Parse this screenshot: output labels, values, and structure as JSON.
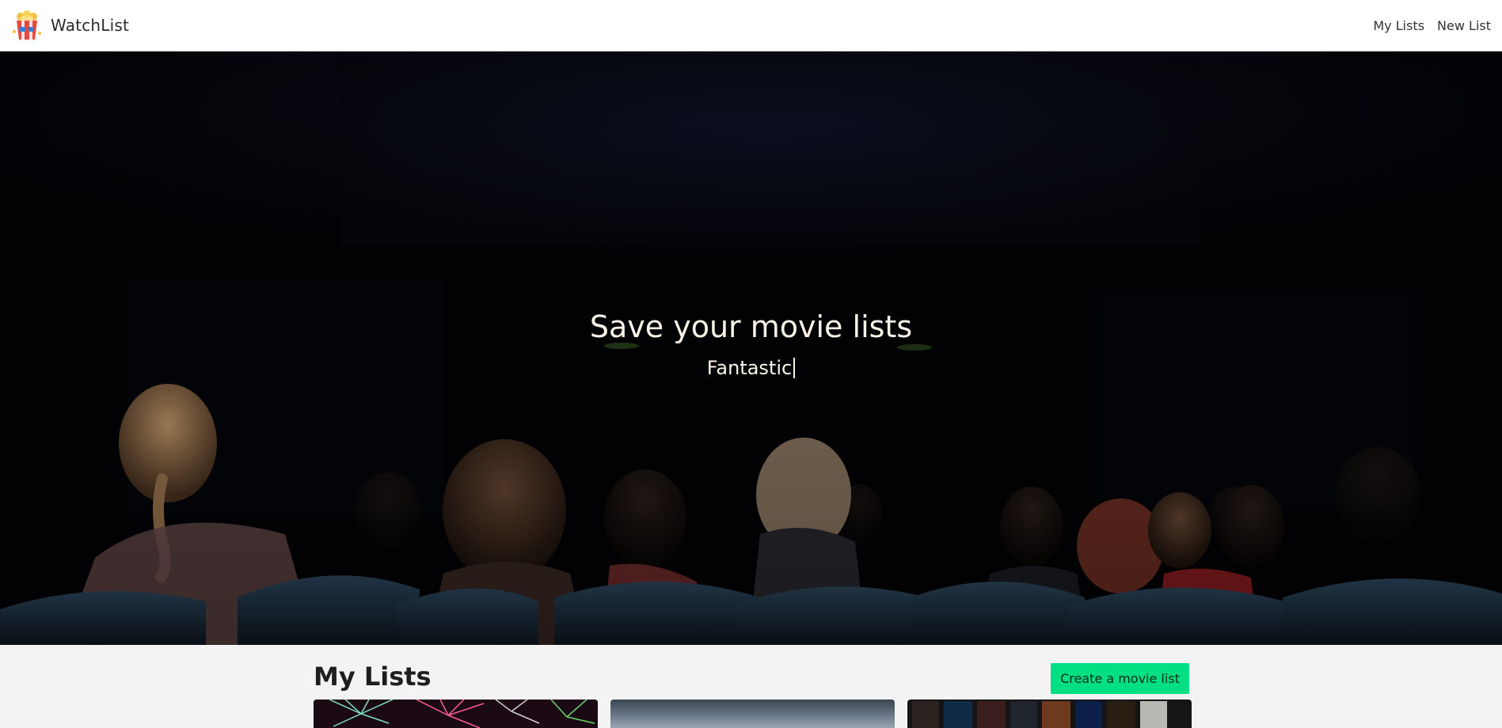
{
  "app": {
    "brand": "WatchList",
    "logo_icon": "popcorn-icon"
  },
  "nav": {
    "items": [
      {
        "label": "My Lists"
      },
      {
        "label": "New List"
      }
    ]
  },
  "hero": {
    "title": "Save your movie lists",
    "typed_text": "Fantastic"
  },
  "lists_section": {
    "title": "My Lists",
    "create_button": "Create a movie list",
    "create_button_color": "#00e083"
  },
  "colors": {
    "navbar_bg": "#ffffff",
    "hero_text": "#fbf4e8",
    "page_bg": "#f3f3f3"
  }
}
